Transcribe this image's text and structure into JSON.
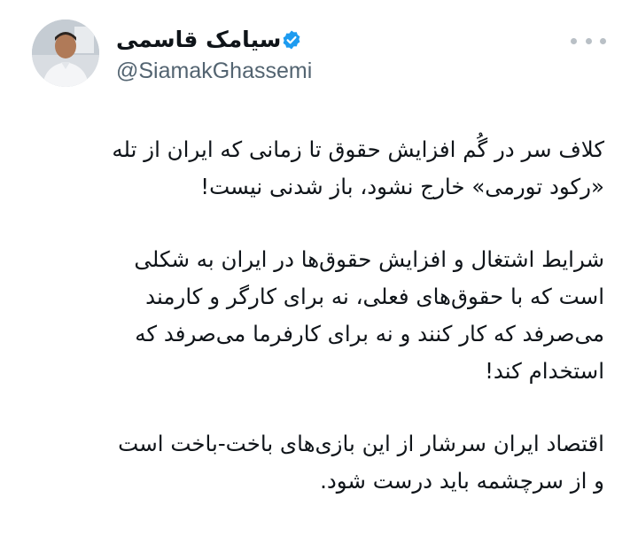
{
  "author": {
    "display_name": "سیامک قاسمی",
    "handle": "@SiamakGhassemi",
    "verified": true,
    "avatar_icon": "profile-photo"
  },
  "colors": {
    "text": "#0f1419",
    "secondary": "#536471",
    "verified_blue": "#1d9bf0",
    "dots": "#b9c0c6"
  },
  "tweet": {
    "paragraphs": [
      {
        "lines": [
          "کلاف سر در گُم افزایش حقوق تا زمانی که ایران از تله",
          "«رکود تورمی» خارج نشود، باز شدنی نیست!"
        ]
      },
      {
        "lines": [
          "شرایط اشتغال و افزایش حقوق‌ها در ایران به شکلی",
          "است که با حقوق‌های فعلی، نه برای کارگر و کارمند",
          "می‌صرفد که کار کنند و نه برای کارفرما می‌صرفد که",
          "استخدام کند!"
        ]
      },
      {
        "lines": [
          "اقتصاد ایران سرشار از این بازی‌های باخت-باخت است",
          "و از سرچشمه باید درست شود."
        ]
      }
    ]
  }
}
